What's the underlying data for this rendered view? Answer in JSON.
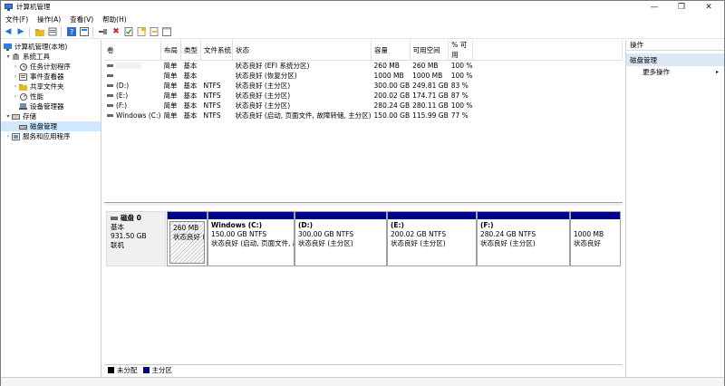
{
  "window": {
    "title": "计算机管理",
    "min_glyph": "—",
    "max_glyph": "❐",
    "close_glyph": "✕"
  },
  "menu": [
    "文件(F)",
    "操作(A)",
    "查看(V)",
    "帮助(H)"
  ],
  "toolbar": {
    "icons": [
      "back-arrow-icon",
      "forward-arrow-icon",
      "up-folder-icon",
      "properties-icon",
      "help-icon",
      "connect-icon",
      "delete-icon",
      "check-icon",
      "new-doc-icon",
      "export-icon"
    ],
    "glyphs": {
      "back": "◀",
      "forward": "▶",
      "delete": "✖"
    },
    "colors": {
      "back": "#2a6fc9",
      "forward": "#2a6fc9",
      "delete": "#c62828"
    }
  },
  "tree": {
    "root": "计算机管理(本地)",
    "items": [
      {
        "label": "系统工具",
        "level": 1,
        "expander": "▾",
        "icon": "tools-icon"
      },
      {
        "label": "任务计划程序",
        "level": 2,
        "expander": "›",
        "icon": "clock-icon"
      },
      {
        "label": "事件查看器",
        "level": 2,
        "expander": "›",
        "icon": "event-icon"
      },
      {
        "label": "共享文件夹",
        "level": 2,
        "expander": "›",
        "icon": "folder-icon"
      },
      {
        "label": "性能",
        "level": 2,
        "expander": "›",
        "icon": "performance-icon"
      },
      {
        "label": "设备管理器",
        "level": 2,
        "expander": "",
        "icon": "device-icon"
      },
      {
        "label": "存储",
        "level": 1,
        "expander": "▾",
        "icon": "storage-icon"
      },
      {
        "label": "磁盘管理",
        "level": 2,
        "expander": "",
        "icon": "disk-icon",
        "selected": true
      },
      {
        "label": "服务和应用程序",
        "level": 1,
        "expander": "›",
        "icon": "services-icon"
      }
    ]
  },
  "volumes": {
    "headers": [
      "卷",
      "布局",
      "类型",
      "文件系统",
      "状态",
      "容量",
      "可用空间",
      "% 可用"
    ],
    "rows": [
      [
        "",
        "简单",
        "基本",
        "",
        "状态良好 (EFI 系统分区)",
        "260 MB",
        "260 MB",
        "100 %"
      ],
      [
        "",
        "简单",
        "基本",
        "",
        "状态良好 (恢复分区)",
        "1000 MB",
        "1000 MB",
        "100 %"
      ],
      [
        "(D:)",
        "简单",
        "基本",
        "NTFS",
        "状态良好 (主分区)",
        "300.00 GB",
        "249.81 GB",
        "83 %"
      ],
      [
        "(E:)",
        "简单",
        "基本",
        "NTFS",
        "状态良好 (主分区)",
        "200.02 GB",
        "174.71 GB",
        "87 %"
      ],
      [
        "(F:)",
        "简单",
        "基本",
        "NTFS",
        "状态良好 (主分区)",
        "280.24 GB",
        "280.11 GB",
        "100 %"
      ],
      [
        "Windows (C:)",
        "简单",
        "基本",
        "NTFS",
        "状态良好 (启动, 页面文件, 故障转储, 主分区)",
        "150.00 GB",
        "115.99 GB",
        "77 %"
      ]
    ]
  },
  "disk": {
    "name": "磁盘 0",
    "type": "基本",
    "size": "931.50 GB",
    "status": "联机",
    "partitions": [
      {
        "name": "",
        "size": "260 MB",
        "status": "状态良好 (E"
      },
      {
        "name": "Windows (C:)",
        "size": "150.00 GB NTFS",
        "status": "状态良好 (启动, 页面文件, 故"
      },
      {
        "name": "(D:)",
        "size": "300.00 GB NTFS",
        "status": "状态良好 (主分区)"
      },
      {
        "name": "(E:)",
        "size": "200.02 GB NTFS",
        "status": "状态良好 (主分区)"
      },
      {
        "name": "(F:)",
        "size": "280.24 GB NTFS",
        "status": "状态良好 (主分区)"
      },
      {
        "name": "",
        "size": "1000 MB",
        "status": "状态良好"
      }
    ]
  },
  "legend": [
    {
      "label": "未分配",
      "color": "#000000"
    },
    {
      "label": "主分区",
      "color": "#00008b"
    }
  ],
  "actions": {
    "header": "操作",
    "section": "磁盘管理",
    "items": [
      {
        "label": "更多操作",
        "arrow": "▸"
      }
    ]
  }
}
